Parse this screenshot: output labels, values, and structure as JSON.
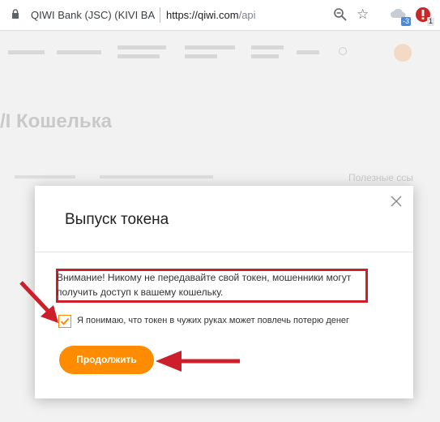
{
  "browser": {
    "site_name": "QIWI Bank (JSC) (KIVI BA",
    "url_domain": "https://qiwi.com",
    "url_path": "/api",
    "ext_weather_badge": "-3",
    "ext_badge": "1"
  },
  "background_page": {
    "heading": "/I Кошелька",
    "side_title": "Полезные ссы"
  },
  "modal": {
    "title": "Выпуск токена",
    "warning": "Внимание! Никому не передавайте свой токен, мошенники могут получить доступ к вашему кошельку.",
    "checkbox_label": "Я понимаю, что токен в чужих руках может повлечь потерю денег",
    "checkbox_checked": true,
    "continue_label": "Продолжить"
  },
  "colors": {
    "accent": "#ff8c00",
    "annotation_red": "#cc1f2b"
  }
}
